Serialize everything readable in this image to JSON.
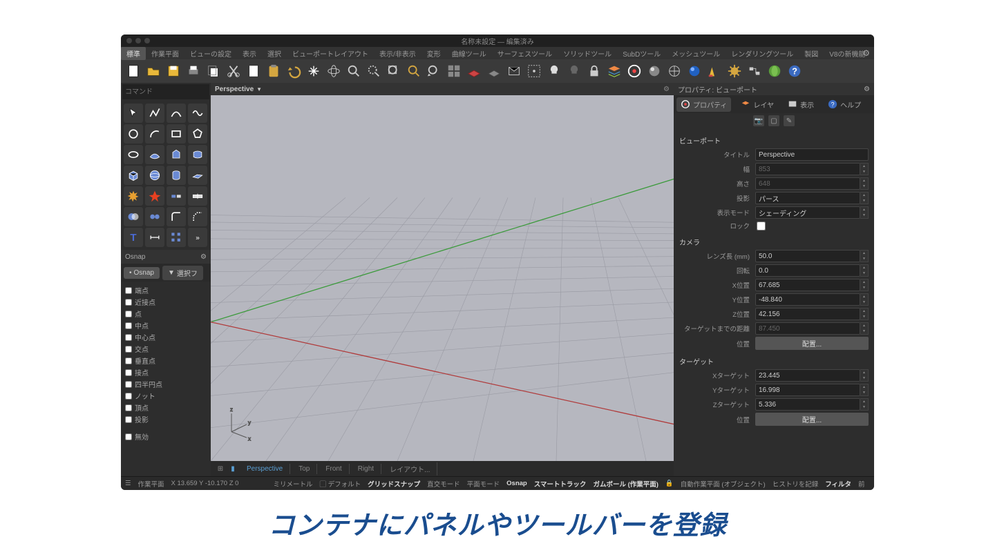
{
  "title": "名称未設定 — 編集済み",
  "menuTabs": [
    "標準",
    "作業平面",
    "ビューの設定",
    "表示",
    "選択",
    "ビューポートレイアウト",
    "表示/非表示",
    "変形",
    "曲線ツール",
    "サーフェスツール",
    "ソリッドツール",
    "SubDツール",
    "メッシュツール",
    "レンダリングツール",
    "製図",
    "V8の新機能"
  ],
  "cmd_placeholder": "コマンド",
  "osnap": {
    "title": "Osnap",
    "tab_osnap": "Osnap",
    "tab_filter": "選択フ",
    "items": [
      "端点",
      "近接点",
      "点",
      "中点",
      "中心点",
      "交点",
      "垂直点",
      "接点",
      "四半円点",
      "ノット",
      "頂点",
      "投影"
    ],
    "disable": "無効"
  },
  "viewport": {
    "label": "Perspective",
    "tabs": [
      "Perspective",
      "Top",
      "Front",
      "Right",
      "レイアウト..."
    ]
  },
  "rightPanel": {
    "header": "プロパティ: ビューポート",
    "tabs": {
      "props": "プロパティ",
      "layer": "レイヤ",
      "display": "表示",
      "help": "ヘルプ"
    },
    "sec_viewport": "ビューポート",
    "sec_camera": "カメラ",
    "sec_target": "ターゲット",
    "rows": {
      "title_l": "タイトル",
      "title_v": "Perspective",
      "width_l": "幅",
      "width_v": "853",
      "height_l": "高さ",
      "height_v": "648",
      "proj_l": "投影",
      "proj_v": "パース",
      "dmode_l": "表示モード",
      "dmode_v": "シェーディング",
      "lock_l": "ロック",
      "lens_l": "レンズ長 (mm)",
      "lens_v": "50.0",
      "rot_l": "回転",
      "rot_v": "0.0",
      "x_l": "X位置",
      "x_v": "67.685",
      "y_l": "Y位置",
      "y_v": "-48.840",
      "z_l": "Z位置",
      "z_v": "42.156",
      "tdist_l": "ターゲットまでの距離",
      "tdist_v": "87.450",
      "pos_l": "位置",
      "pos_btn": "配置...",
      "tx_l": "Xターゲット",
      "tx_v": "23.445",
      "ty_l": "Yターゲット",
      "ty_v": "16.998",
      "tz_l": "Zターゲット",
      "tz_v": "5.336"
    }
  },
  "status": {
    "cplane": "作業平面",
    "coords": "X 13.659 Y -10.170 Z 0",
    "units": "ミリメートル",
    "layer": "デフォルト",
    "gridsnap": "グリッドスナップ",
    "ortho": "直交モード",
    "planar": "平面モード",
    "osnap": "Osnap",
    "smart": "スマートトラック",
    "gumball": "ガムボール (作業平面)",
    "autocplane": "自動作業平面 (オブジェクト)",
    "history": "ヒストリを記録",
    "filter": "フィルタ",
    "prev": "前"
  },
  "caption": "コンテナにパネルやツールバーを登録"
}
